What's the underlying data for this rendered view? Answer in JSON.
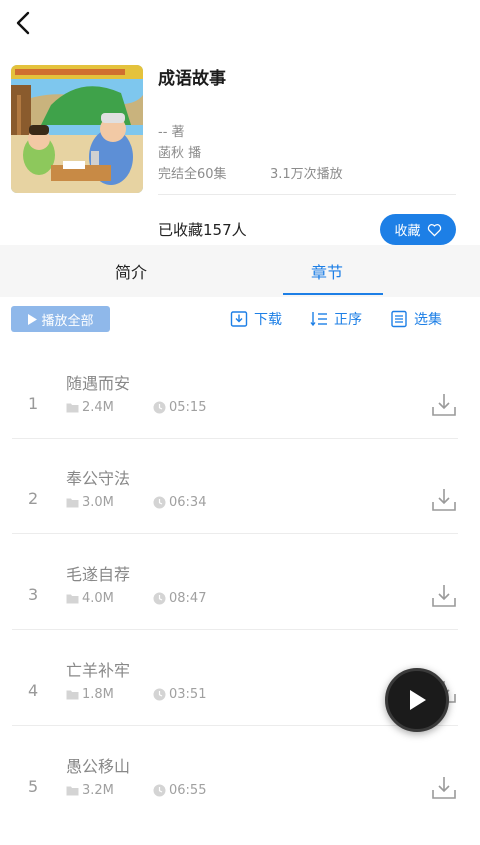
{
  "header": {
    "back_icon": "chevron-left-icon"
  },
  "album": {
    "title": "成语故事",
    "author": "-- 著",
    "narrator": "菡秋 播",
    "episodes": "完结全60集",
    "plays": "3.1万次播放",
    "favorites": "已收藏157人",
    "favorite_button": "收藏",
    "cover_icon": "album-cover-illustration"
  },
  "tabs": [
    {
      "label": "简介",
      "active": false
    },
    {
      "label": "章节",
      "active": true
    }
  ],
  "toolbar": {
    "play_all": "播放全部",
    "download": "下载",
    "order": "正序",
    "select": "选集"
  },
  "chapters": [
    {
      "num": "1",
      "title": "随遇而安",
      "size": "2.4M",
      "duration": "05:15"
    },
    {
      "num": "2",
      "title": "奉公守法",
      "size": "3.0M",
      "duration": "06:34"
    },
    {
      "num": "3",
      "title": "毛遂自荐",
      "size": "4.0M",
      "duration": "08:47"
    },
    {
      "num": "4",
      "title": "亡羊补牢",
      "size": "1.8M",
      "duration": "03:51"
    },
    {
      "num": "5",
      "title": "愚公移山",
      "size": "3.2M",
      "duration": "06:55"
    }
  ],
  "colors": {
    "accent": "#1d7fe6",
    "play_all_bg": "#8fb8ea",
    "fab_bg": "#1b1b1b"
  }
}
